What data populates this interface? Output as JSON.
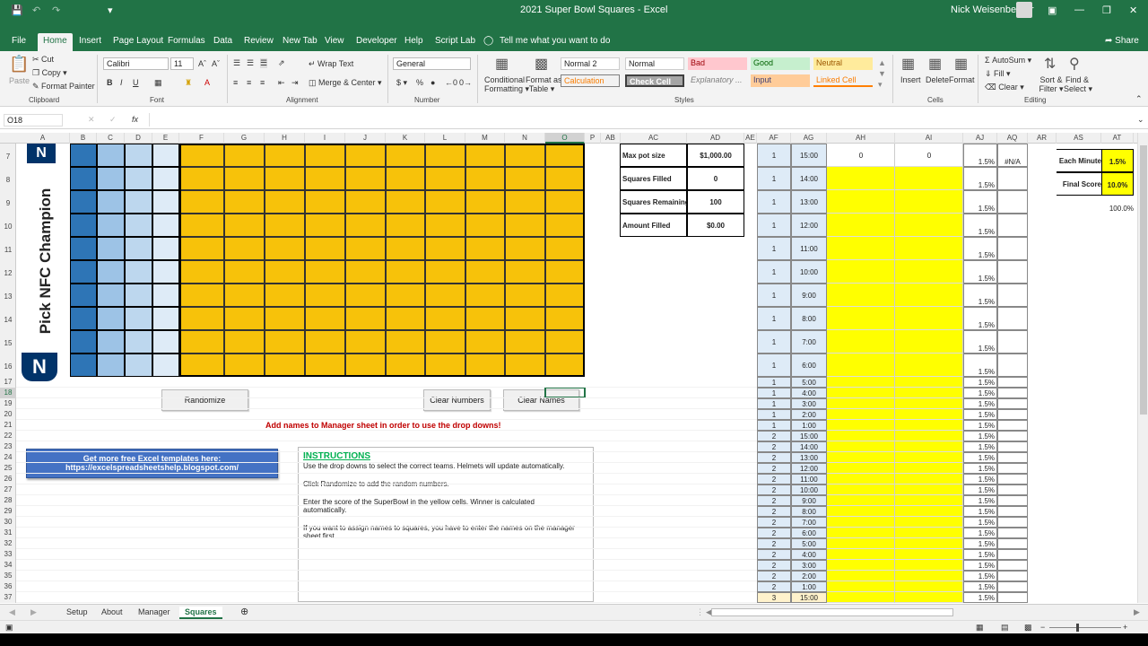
{
  "window": {
    "title": "2021 Super Bowl Squares  -  Excel",
    "user": "Nick Weisenberger"
  },
  "menu": {
    "tabs": [
      "File",
      "Home",
      "Insert",
      "Page Layout",
      "Formulas",
      "Data",
      "Review",
      "New Tab",
      "View",
      "Developer",
      "Help",
      "Script Lab"
    ],
    "tell_me": "Tell me what you want to do",
    "share": "Share"
  },
  "ribbon": {
    "clipboard": {
      "paste": "Paste",
      "cut": "Cut",
      "copy": "Copy",
      "painter": "Format Painter",
      "label": "Clipboard"
    },
    "font": {
      "name": "Calibri",
      "size": "11",
      "label": "Font"
    },
    "alignment": {
      "wrap": "Wrap Text",
      "merge": "Merge & Center",
      "label": "Alignment"
    },
    "number": {
      "format": "General",
      "label": "Number"
    },
    "styles": {
      "cond": "Conditional",
      "cond2": "Formatting",
      "table": "Format as",
      "table2": "Table",
      "normal2": "Normal 2",
      "normal": "Normal",
      "bad": "Bad",
      "good": "Good",
      "neutral": "Neutral",
      "calc": "Calculation",
      "check": "Check Cell",
      "explan": "Explanatory ...",
      "input": "Input",
      "linked": "Linked Cell",
      "label": "Styles"
    },
    "cells": {
      "insert": "Insert",
      "delete": "Delete",
      "format": "Format",
      "label": "Cells"
    },
    "editing": {
      "autosum": "AutoSum",
      "fill": "Fill",
      "clear": "Clear",
      "sort": "Sort &",
      "sort2": "Filter",
      "find": "Find &",
      "find2": "Select",
      "label": "Editing"
    }
  },
  "formula_bar": {
    "name_box": "O18",
    "fx": "fx"
  },
  "columns": [
    "A",
    "B",
    "C",
    "D",
    "E",
    "F",
    "G",
    "H",
    "I",
    "J",
    "K",
    "L",
    "M",
    "N",
    "O",
    "P",
    "AB",
    "AC",
    "AD",
    "AE",
    "AF",
    "AG",
    "AH",
    "AI",
    "AJ",
    "AQ",
    "AR",
    "AS",
    "AT"
  ],
  "rows_tall": [
    "7",
    "8",
    "9",
    "10",
    "11",
    "12",
    "13",
    "14",
    "15",
    "16"
  ],
  "rows_short": [
    "17",
    "18",
    "19",
    "20",
    "21",
    "22",
    "23",
    "24",
    "25",
    "26",
    "27",
    "28",
    "29",
    "30",
    "31",
    "32",
    "33",
    "34",
    "35",
    "36",
    "37"
  ],
  "grid": {
    "side_label": "Pick NFC Champion"
  },
  "buttons": {
    "randomize": "Randomize",
    "clear_numbers": "Clear Numbers",
    "clear_names": "Clear Names"
  },
  "warning": "Add names to Manager sheet in order to use the drop downs!",
  "promo": {
    "line1": "Get more free Excel templates here:",
    "line2": "https://excelspreadsheetshelp.blogspot.com/"
  },
  "instructions": {
    "title": "INSTRUCTIONS",
    "p1": "Use the drop downs to select the correct teams. Helmets will update automatically.",
    "p2": "Click Randomize to add the random numbers.",
    "p3a": "Enter the score of the SuperBowl in the yellow cells. Winner is calculated",
    "p3b": "automatically.",
    "p4a": "If you want to assign names to squares, you have to enter the names on the manager",
    "p4b": "sheet first."
  },
  "summary": [
    {
      "label": "Max pot size",
      "value": "$1,000.00"
    },
    {
      "label": "Squares Filled",
      "value": "0"
    },
    {
      "label": "Squares Remaining",
      "value": "100"
    },
    {
      "label": "Amount Filled",
      "value": "$0.00"
    }
  ],
  "settings": [
    {
      "label": "Each Minute",
      "value": "1.5%"
    },
    {
      "label": "Final Score",
      "value": "10.0%"
    }
  ],
  "total_pct": "100.0%",
  "score_row": {
    "ah": "0",
    "ai": "0",
    "aq": "#N/A"
  },
  "schedule": [
    {
      "q": "1",
      "t": "15:00",
      "p": "1.5%"
    },
    {
      "q": "1",
      "t": "14:00",
      "p": "1.5%"
    },
    {
      "q": "1",
      "t": "13:00",
      "p": "1.5%"
    },
    {
      "q": "1",
      "t": "12:00",
      "p": "1.5%"
    },
    {
      "q": "1",
      "t": "11:00",
      "p": "1.5%"
    },
    {
      "q": "1",
      "t": "10:00",
      "p": "1.5%"
    },
    {
      "q": "1",
      "t": "9:00",
      "p": "1.5%"
    },
    {
      "q": "1",
      "t": "8:00",
      "p": "1.5%"
    },
    {
      "q": "1",
      "t": "7:00",
      "p": "1.5%"
    },
    {
      "q": "1",
      "t": "6:00",
      "p": "1.5%"
    },
    {
      "q": "1",
      "t": "5:00",
      "p": "1.5%"
    },
    {
      "q": "1",
      "t": "4:00",
      "p": "1.5%"
    },
    {
      "q": "1",
      "t": "3:00",
      "p": "1.5%"
    },
    {
      "q": "1",
      "t": "2:00",
      "p": "1.5%"
    },
    {
      "q": "1",
      "t": "1:00",
      "p": "1.5%"
    },
    {
      "q": "2",
      "t": "15:00",
      "p": "1.5%"
    },
    {
      "q": "2",
      "t": "14:00",
      "p": "1.5%"
    },
    {
      "q": "2",
      "t": "13:00",
      "p": "1.5%"
    },
    {
      "q": "2",
      "t": "12:00",
      "p": "1.5%"
    },
    {
      "q": "2",
      "t": "11:00",
      "p": "1.5%"
    },
    {
      "q": "2",
      "t": "10:00",
      "p": "1.5%"
    },
    {
      "q": "2",
      "t": "9:00",
      "p": "1.5%"
    },
    {
      "q": "2",
      "t": "8:00",
      "p": "1.5%"
    },
    {
      "q": "2",
      "t": "7:00",
      "p": "1.5%"
    },
    {
      "q": "2",
      "t": "6:00",
      "p": "1.5%"
    },
    {
      "q": "2",
      "t": "5:00",
      "p": "1.5%"
    },
    {
      "q": "2",
      "t": "4:00",
      "p": "1.5%"
    },
    {
      "q": "2",
      "t": "3:00",
      "p": "1.5%"
    },
    {
      "q": "2",
      "t": "2:00",
      "p": "1.5%"
    },
    {
      "q": "2",
      "t": "1:00",
      "p": "1.5%"
    },
    {
      "q": "3",
      "t": "15:00",
      "p": "1.5%"
    }
  ],
  "sheet_tabs": [
    "Setup",
    "About",
    "Manager",
    "Squares"
  ],
  "active_tab": "Squares",
  "colors": {
    "excel_green": "#217346",
    "grid_orange": "#f7c20a",
    "score_yellow": "#ffff00",
    "blue_dark": "#2e75b6",
    "blue_mid": "#9dc3e6",
    "blue_light": "#bdd7ee",
    "blue_lighter": "#deebf7"
  }
}
